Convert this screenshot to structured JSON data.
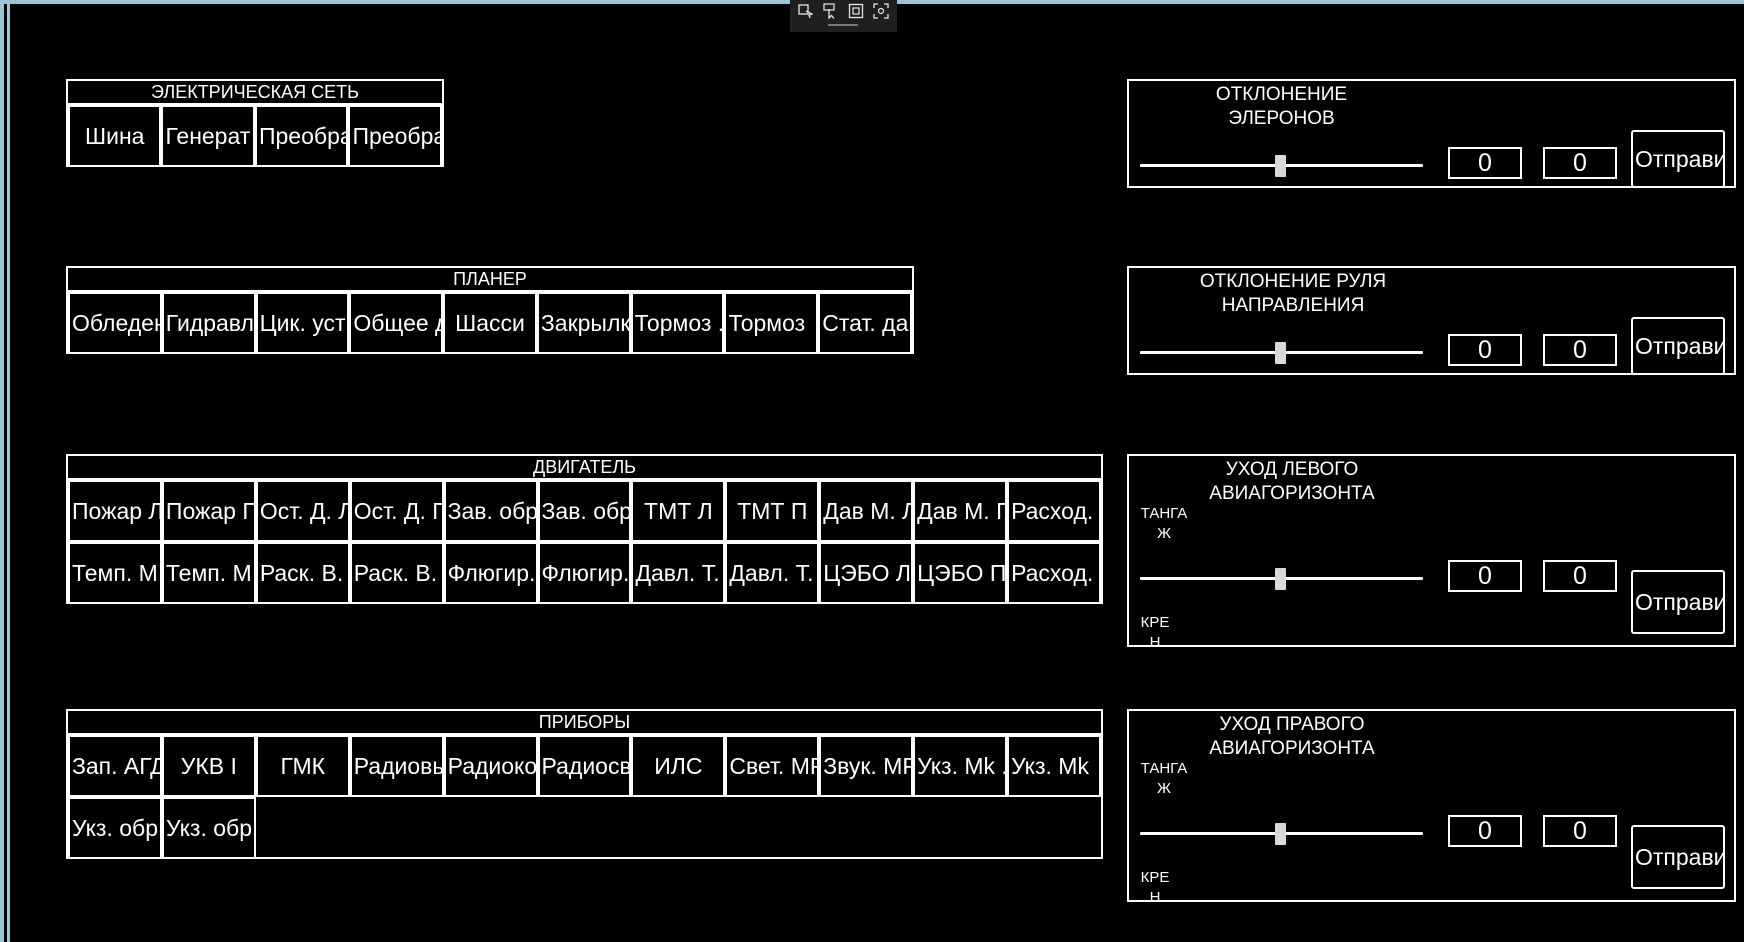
{
  "toolbar": {
    "icons": [
      "select-element-icon",
      "pointer-icon",
      "layout-bounds-icon",
      "track-focus-icon"
    ]
  },
  "electrical": {
    "title": "ЭЛЕКТРИЧЕСКАЯ СЕТЬ",
    "buttons": [
      "Шина",
      "Генерат",
      "Преобра",
      "Преобра"
    ]
  },
  "airframe": {
    "title": "ПЛАНЕР",
    "buttons": [
      "Обледен",
      "Гидравл",
      "Цик. уст",
      "Общее д",
      "Шасси",
      "Закрылк",
      "Тормоз .",
      "Тормоз",
      "Стат. дав"
    ]
  },
  "engine": {
    "title": "ДВИГАТЕЛЬ",
    "row1": [
      "Пожар Л",
      "Пожар П",
      "Ост. Д. Л",
      "Ост. Д. П",
      "Зав. обр",
      "Зав. обр",
      "ТМТ Л",
      "ТМТ П",
      "Дав М. Л",
      "Дав М. П",
      "Расход. Л"
    ],
    "row2": [
      "Темп. М",
      "Темп. М",
      "Раск. В. Л",
      "Раск. В. П",
      "Флюгир.",
      "Флюгир.",
      "Давл. Т.",
      "Давл. Т.",
      "ЦЭБО Л",
      "ЦЭБО П",
      "Расход. П"
    ]
  },
  "instruments": {
    "title": "ПРИБОРЫ",
    "row1": [
      "Зап. АГД",
      "УКВ I",
      "ГМК",
      "Радиовы",
      "Радиоко",
      "Радиосв",
      "ИЛС",
      "Свет. МР",
      "Звук. МР",
      "Укз. Mk .",
      "Укз. Mk"
    ],
    "row2": [
      "Укз. обр",
      "Укз. обр"
    ]
  },
  "ailerons": {
    "title": "ОТКЛОНЕНИЕ\nЭЛЕРОНОВ",
    "value1": "0",
    "value2": "0",
    "send": "Отправи",
    "slider_level": 0.5
  },
  "rudder": {
    "title": "ОТКЛОНЕНИЕ РУЛЯ\nНАПРАВЛЕНИЯ",
    "value1": "0",
    "value2": "0",
    "send": "Отправи",
    "slider_level": 0.5
  },
  "left_horizon": {
    "title": "УХОД ЛЕВОГО\nАВИАГОРИЗОНТА",
    "pitch_label": "ТАНГА\nЖ",
    "roll_label": "КРЕ\nН",
    "value1": "0",
    "value2": "0",
    "send": "Отправи",
    "slider_level": 0.5
  },
  "right_horizon": {
    "title": "УХОД ПРАВОГО\nАВИАГОРИЗОНТА",
    "pitch_label": "ТАНГА\nЖ",
    "roll_label": "КРЕ\nН",
    "value1": "0",
    "value2": "0",
    "send": "Отправи",
    "slider_level": 0.5
  }
}
